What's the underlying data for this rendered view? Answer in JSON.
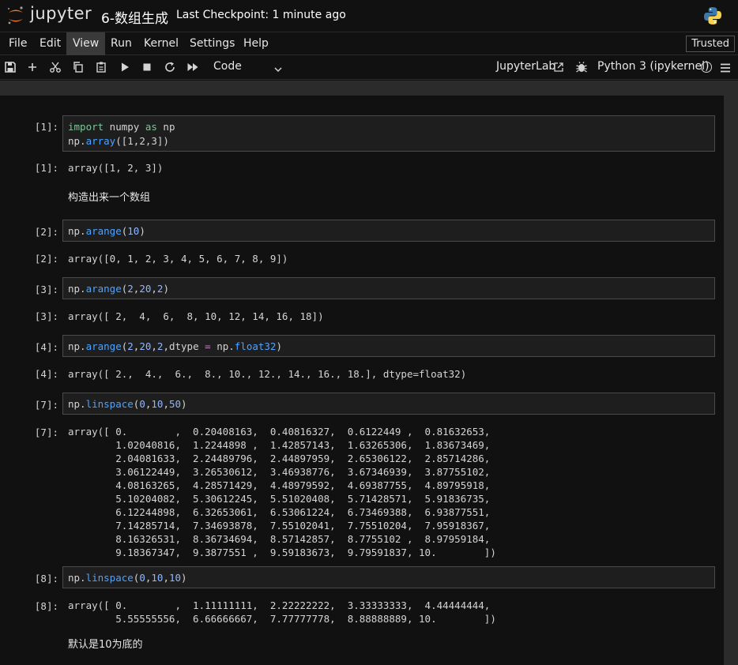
{
  "header": {
    "logo_text": "jupyter",
    "notebook_title": "6-数组生成",
    "checkpoint": "Last Checkpoint: 1 minute ago"
  },
  "menu": {
    "items": [
      "File",
      "Edit",
      "View",
      "Run",
      "Kernel",
      "Settings",
      "Help"
    ],
    "active": "View",
    "trusted": "Trusted"
  },
  "toolbar": {
    "icons": [
      "save-icon",
      "add-cell-icon",
      "cut-icon",
      "copy-icon",
      "paste-icon",
      "run-icon",
      "stop-icon",
      "restart-icon",
      "run-all-icon"
    ],
    "cell_type": "Code",
    "jupyterlab": "JupyterLab",
    "kernel": "Python 3 (ipykernel)"
  },
  "cells": {
    "c1": {
      "in_prompt": "[1]:",
      "code_line1": {
        "kw1": "import",
        "mod": " numpy ",
        "kw2": "as",
        "alias": " np"
      },
      "code_line2": {
        "obj": "np.",
        "fn": "array",
        "args": "([1,2,3])"
      },
      "out_prompt": "[1]:",
      "output": "array([1, 2, 3])"
    },
    "md1": "构造出来一个数组",
    "c2": {
      "in_prompt": "[2]:",
      "code": {
        "obj": "np.",
        "fn": "arange",
        "open": "(",
        "arg": "10",
        "close": ")"
      },
      "out_prompt": "[2]:",
      "output": "array([0, 1, 2, 3, 4, 5, 6, 7, 8, 9])"
    },
    "c3": {
      "in_prompt": "[3]:",
      "code": {
        "obj": "np.",
        "fn": "arange",
        "open": "(",
        "a1": "2",
        "c1": ",",
        "a2": "20",
        "c2": ",",
        "a3": "2",
        "close": ")"
      },
      "out_prompt": "[3]:",
      "output": "array([ 2,  4,  6,  8, 10, 12, 14, 16, 18])"
    },
    "c4": {
      "in_prompt": "[4]:",
      "code": {
        "obj": "np.",
        "fn": "arange",
        "open": "(",
        "a1": "2",
        "c1": ",",
        "a2": "20",
        "c2": ",",
        "a3": "2",
        "c3": ",dtype ",
        "eq": "=",
        "obj2": " np.",
        "fn2": "float32",
        "close": ")"
      },
      "out_prompt": "[4]:",
      "output": "array([ 2.,  4.,  6.,  8., 10., 12., 14., 16., 18.], dtype=float32)"
    },
    "c7": {
      "in_prompt": "[7]:",
      "code": {
        "obj": "np.",
        "fn": "linspace",
        "open": "(",
        "a1": "0",
        "c1": ",",
        "a2": "10",
        "c2": ",",
        "a3": "50",
        "close": ")"
      },
      "out_prompt": "[7]:",
      "output_lines": [
        "array([ 0.        ,  0.20408163,  0.40816327,  0.6122449 ,  0.81632653,",
        "        1.02040816,  1.2244898 ,  1.42857143,  1.63265306,  1.83673469,",
        "        2.04081633,  2.24489796,  2.44897959,  2.65306122,  2.85714286,",
        "        3.06122449,  3.26530612,  3.46938776,  3.67346939,  3.87755102,",
        "        4.08163265,  4.28571429,  4.48979592,  4.69387755,  4.89795918,",
        "        5.10204082,  5.30612245,  5.51020408,  5.71428571,  5.91836735,",
        "        6.12244898,  6.32653061,  6.53061224,  6.73469388,  6.93877551,",
        "        7.14285714,  7.34693878,  7.55102041,  7.75510204,  7.95918367,",
        "        8.16326531,  8.36734694,  8.57142857,  8.7755102 ,  8.97959184,",
        "        9.18367347,  9.3877551 ,  9.59183673,  9.79591837, 10.        ])"
      ]
    },
    "c8": {
      "in_prompt": "[8]:",
      "code": {
        "obj": "np.",
        "fn": "linspace",
        "open": "(",
        "a1": "0",
        "c1": ",",
        "a2": "10",
        "c2": ",",
        "a3": "10",
        "close": ")"
      },
      "out_prompt": "[8]:",
      "output_lines": [
        "array([ 0.        ,  1.11111111,  2.22222222,  3.33333333,  4.44444444,",
        "        5.55555556,  6.66666667,  7.77777778,  8.88888889, 10.        ])"
      ]
    },
    "md2": "默认是10为底的"
  }
}
